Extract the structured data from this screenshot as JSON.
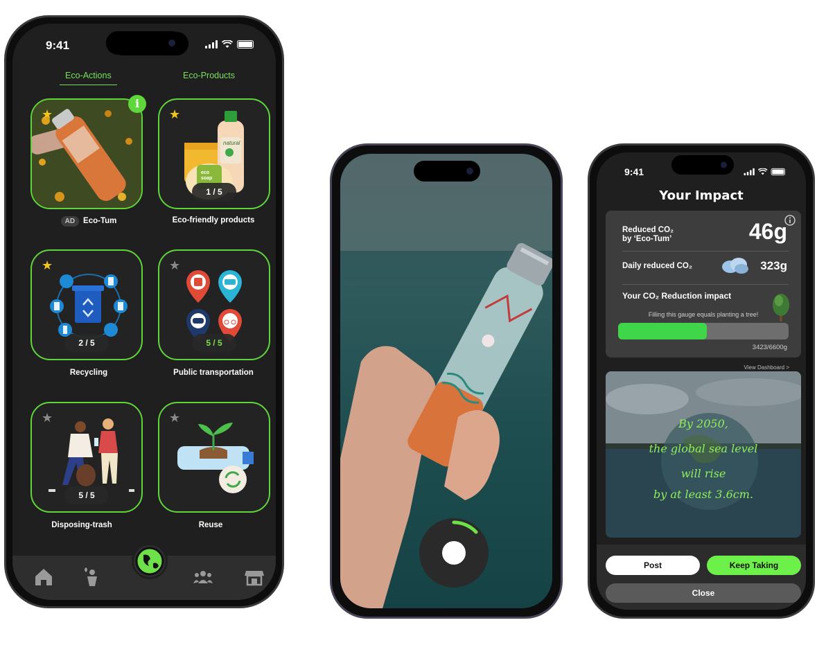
{
  "phone1": {
    "status_time": "9:41",
    "tabs": [
      {
        "label": "Eco-Actions",
        "active": true
      },
      {
        "label": "Eco-Products",
        "active": false
      }
    ],
    "cards": [
      {
        "label": "Eco-Tum",
        "ad_badge": "AD",
        "progress": "",
        "star": "gold",
        "info_badge": "i",
        "icon": "water-bottle-photo"
      },
      {
        "label": "Eco-friendly products",
        "progress": "1 / 5",
        "star": "gold",
        "icon": "eco-products-illustration",
        "bottle_label": "natural",
        "soap_label": "eco soap"
      },
      {
        "label": "Recycling",
        "progress": "2 / 5",
        "star": "gold",
        "icon": "recycling-bin-illustration"
      },
      {
        "label": "Public transportation",
        "progress": "5 / 5",
        "star": "gray",
        "icon": "transport-pins-illustration"
      },
      {
        "label": "Disposing-trash",
        "progress": "5 / 5",
        "star": "gray",
        "icon": "people-picking-trash-illustration"
      },
      {
        "label": "Reuse",
        "progress": "",
        "star": "gray",
        "icon": "reuse-plant-illustration"
      }
    ],
    "nav": [
      "home-icon",
      "person-leaf-icon",
      "earth-icon",
      "community-icon",
      "store-icon"
    ]
  },
  "phone3": {
    "status_time": "9:41",
    "title": "Your Impact",
    "reduced_label_line1": "Reduced CO₂",
    "reduced_label_line2": "by ‘Eco-Tum’",
    "reduced_value": "46g",
    "daily_label": "Daily reduced CO₂",
    "daily_value": "323g",
    "impact_label": "Your CO₂ Reduction impact",
    "gauge_subtitle": "Filling this gauge equals planting a tree!",
    "gauge_fraction": 0.52,
    "gauge_value": "3423/6600g",
    "view_dashboard": "View Dashboard  >",
    "photo_text": [
      "By 2050,",
      "the global sea level",
      "will rise",
      "by at least 3.6cm."
    ],
    "buttons": {
      "post": "Post",
      "keep": "Keep Taking",
      "close": "Close"
    }
  },
  "colors": {
    "accent_green": "#5fd63a",
    "gauge_green": "#3fd64a",
    "keep_button": "#6ef04a",
    "card_bg": "#232323",
    "screen_bg": "#1f1f1f"
  }
}
